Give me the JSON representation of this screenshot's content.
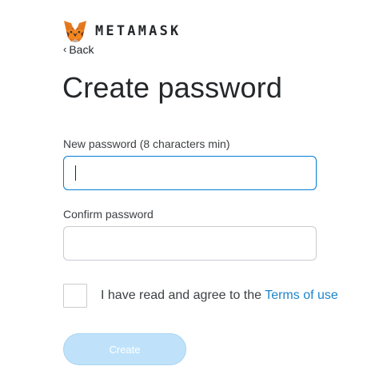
{
  "brand": {
    "logo_icon": "metamask-fox-icon",
    "wordmark": "METAMASK"
  },
  "nav": {
    "back_icon": "chevron-left-icon",
    "back_glyph": "‹",
    "back_label": "Back"
  },
  "page": {
    "title": "Create password"
  },
  "form": {
    "new_password": {
      "label": "New password (8 characters min)",
      "value": "",
      "focused": true
    },
    "confirm_password": {
      "label": "Confirm password",
      "value": ""
    },
    "agree": {
      "checked": false,
      "text": "I have read and agree to the ",
      "link_text": "Terms of use"
    },
    "create_button": {
      "label": "Create",
      "disabled": true
    }
  },
  "colors": {
    "link": "#1e84c9",
    "focus_border": "#037dd6",
    "disabled_button_bg": "#bfe2fa",
    "text": "#24272a"
  }
}
